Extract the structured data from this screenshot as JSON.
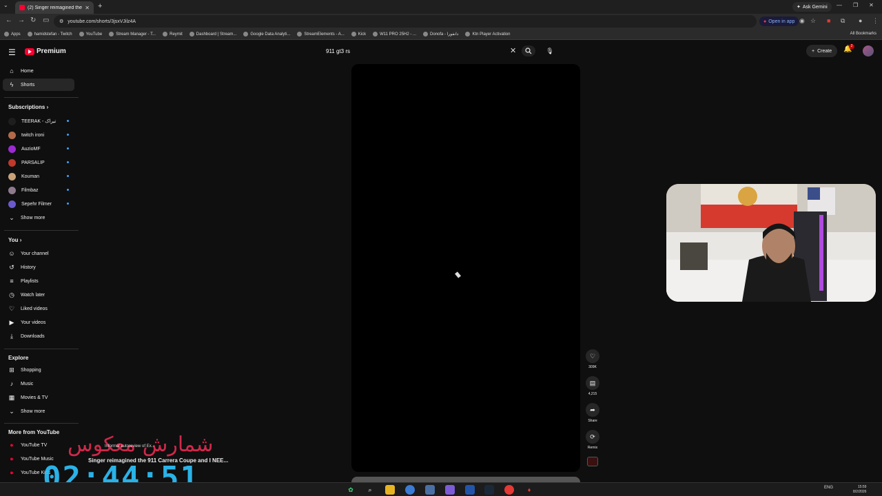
{
  "browser": {
    "tab_title": "(2) Singer reimagined the 911 ...",
    "url": "youtube.com/shorts/3jsxVJilz4A",
    "ask_gemini": "Ask Gemini",
    "open_in_app": "Open in app",
    "bookmarks": [
      "Apps",
      "hamidstefan - Twitch",
      "YouTube",
      "Stream Manager - T...",
      "Reymit",
      "Dashboard | Stream...",
      "Google Data Analyti...",
      "StreamElements - A...",
      "Kick",
      "W11 PRO 25H2 - ...",
      "Donofa - دانفورا",
      "Ktn Player Activation"
    ],
    "all_bookmarks": "All Bookmarks"
  },
  "header": {
    "logo_text": "Premium",
    "search_value": "911 gt3 rs",
    "create_label": "Create",
    "notif_count": "2"
  },
  "sidebar": {
    "main": [
      {
        "label": "Home",
        "icon": "home-icon"
      },
      {
        "label": "Shorts",
        "icon": "shorts-icon"
      }
    ],
    "subscriptions_title": "Subscriptions",
    "subscriptions": [
      {
        "label": "TEERAK - تیراک",
        "color": "#1e1e1e"
      },
      {
        "label": "twitch ironi",
        "color": "#b36a4a"
      },
      {
        "label": "AuzioMF",
        "color": "#9c2ad1"
      },
      {
        "label": "PARSALIP",
        "color": "#c0392b"
      },
      {
        "label": "Kouman",
        "color": "#c9a27a"
      },
      {
        "label": "Filmbaz",
        "color": "#8e7a8c"
      },
      {
        "label": "Sepehr Filmer",
        "color": "#6a5acd"
      }
    ],
    "show_more": "Show more",
    "you_title": "You",
    "you": [
      {
        "label": "Your channel",
        "icon": "channel-icon"
      },
      {
        "label": "History",
        "icon": "history-icon"
      },
      {
        "label": "Playlists",
        "icon": "playlists-icon"
      },
      {
        "label": "Watch later",
        "icon": "clock-icon"
      },
      {
        "label": "Liked videos",
        "icon": "like-icon"
      },
      {
        "label": "Your videos",
        "icon": "video-icon"
      },
      {
        "label": "Downloads",
        "icon": "download-icon"
      }
    ],
    "explore_title": "Explore",
    "explore": [
      {
        "label": "Shopping",
        "icon": "bag-icon"
      },
      {
        "label": "Music",
        "icon": "music-icon"
      },
      {
        "label": "Movies & TV",
        "icon": "film-icon"
      }
    ],
    "explore_more": "Show more",
    "more_title": "More from YouTube",
    "more": [
      {
        "label": "YouTube TV"
      },
      {
        "label": "YouTube Music"
      },
      {
        "label": "YouTube Kids"
      }
    ]
  },
  "shorts": {
    "likes": "309K",
    "comments": "4,215",
    "share": "Share",
    "remix": "Remix"
  },
  "overlay": {
    "persian_text": "شمارش معکوس",
    "subtext": "Informal autoreview of Ex...",
    "title": "Singer reimagined the 911 Carrera Coupe and I NEE...",
    "countdown": "02:44:51"
  },
  "taskbar": {
    "lang": "ENG",
    "time": "15:59",
    "date": "8/2/2026"
  },
  "colors": {
    "yt_red": "#ff0033",
    "accent_blue": "#3ea6ff",
    "overlay_red": "#d0284a",
    "overlay_cyan": "#2ec4ff"
  }
}
